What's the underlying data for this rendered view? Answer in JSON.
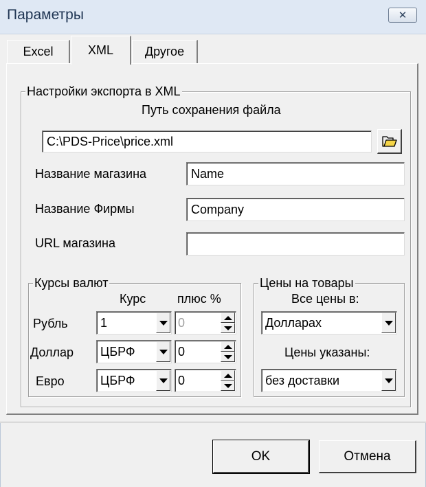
{
  "window": {
    "title": "Параметры",
    "close_glyph": "✕"
  },
  "tabs": [
    {
      "label": "Excel"
    },
    {
      "label": "XML"
    },
    {
      "label": "Другое"
    }
  ],
  "xml_settings": {
    "group_title": "Настройки экспорта в XML",
    "path_label": "Путь сохранения файла",
    "path_value": "C:\\PDS-Price\\price.xml",
    "shop_name_label": "Название магазина",
    "shop_name_value": "Name",
    "company_label": "Название Фирмы",
    "company_value": "Company",
    "url_label": "URL магазина",
    "url_value": ""
  },
  "currency": {
    "group_title": "Курсы валют",
    "col_rate": "Курс",
    "col_plus": "плюс %",
    "rows": [
      {
        "name": "Рубль",
        "rate": "1",
        "plus": "0",
        "plus_enabled": false
      },
      {
        "name": "Доллар",
        "rate": "ЦБРФ",
        "plus": "0",
        "plus_enabled": true
      },
      {
        "name": "Евро",
        "rate": "ЦБРФ",
        "plus": "0",
        "plus_enabled": true
      }
    ]
  },
  "prices": {
    "group_title": "Цены на товары",
    "all_prices_label": "Все цены в:",
    "all_prices_value": "Долларах",
    "prices_shown_label": "Цены указаны:",
    "prices_shown_value": "без доставки"
  },
  "buttons": {
    "ok": "OK",
    "cancel": "Отмена"
  },
  "icons": {
    "folder": "folder-open-icon",
    "folder_color": "#f5d547"
  }
}
